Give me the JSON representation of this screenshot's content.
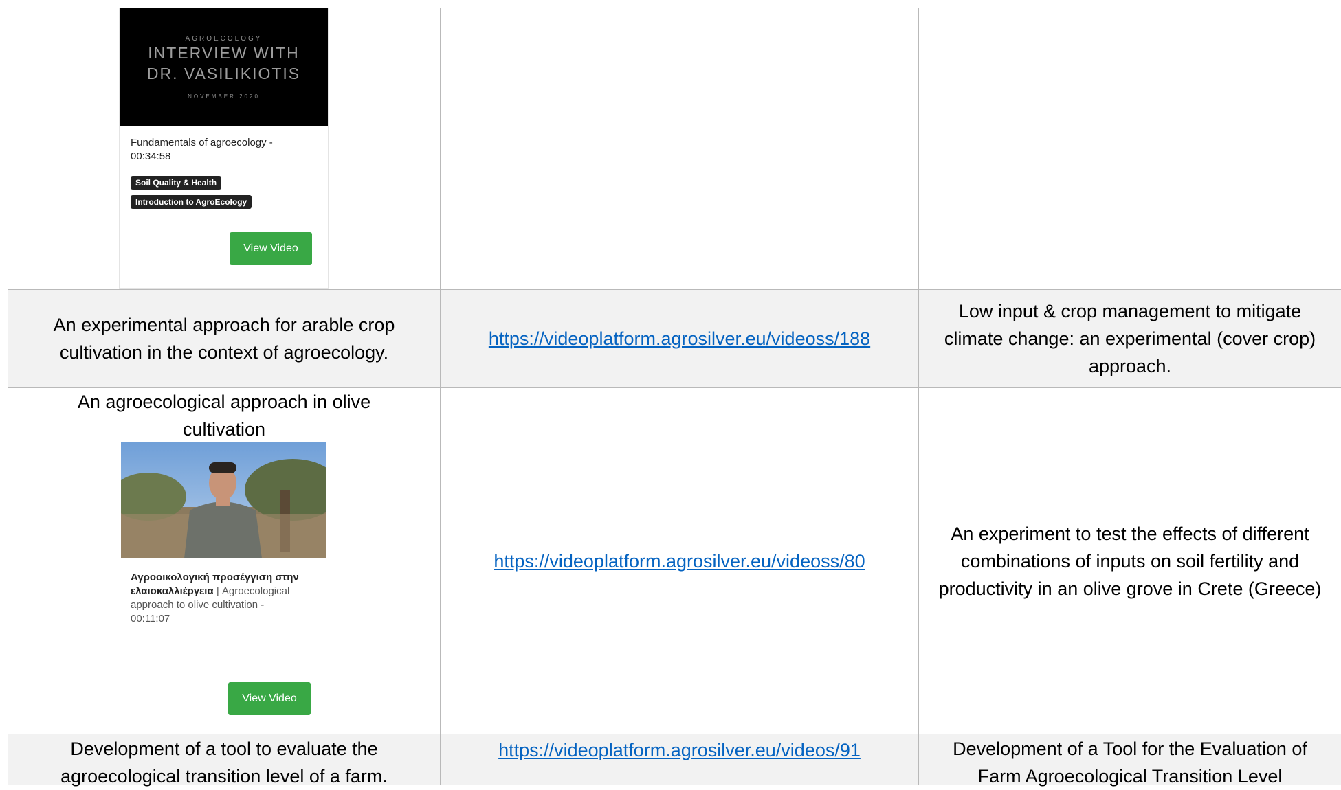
{
  "row1": {
    "card": {
      "thumb_small_top": "AGROECOLOGY",
      "thumb_line1": "INTERVIEW WITH",
      "thumb_line2": "DR. VASILIKIOTIS",
      "thumb_small_bottom": "NOVEMBER 2020",
      "title": "Fundamentals of agroecology - 00:34:58",
      "tags": [
        "Soil Quality & Health",
        "Introduction to AgroEcology"
      ],
      "button": "View Video"
    }
  },
  "row2": {
    "description": "An experimental approach for arable crop cultivation in the context of agroecology.",
    "link": "https://videoplatform.agrosilver.eu/videoss/188",
    "title": "Low input & crop management to mitigate climate change: an experimental (cover crop) approach."
  },
  "row3": {
    "description": "An agroecological approach in olive cultivation",
    "card": {
      "title_greek": "Αγροοικολογική προσέγγιση στην ελαιοκαλλιέργεια",
      "title_rest": " | Agroecological approach to olive cultivation - 00:11:07",
      "button": "View Video"
    },
    "link": "https://videoplatform.agrosilver.eu/videoss/80",
    "title": "An experiment to test the effects of different combinations of inputs on soil fertility and productivity in an olive grove in Crete (Greece)"
  },
  "row4": {
    "description": "Development of a tool to evaluate the agroecological transition level of a farm.",
    "link": "https://videoplatform.agrosilver.eu/videos/91",
    "title": "Development of a Tool for the Evaluation of Farm Agroecological Transition Level"
  }
}
